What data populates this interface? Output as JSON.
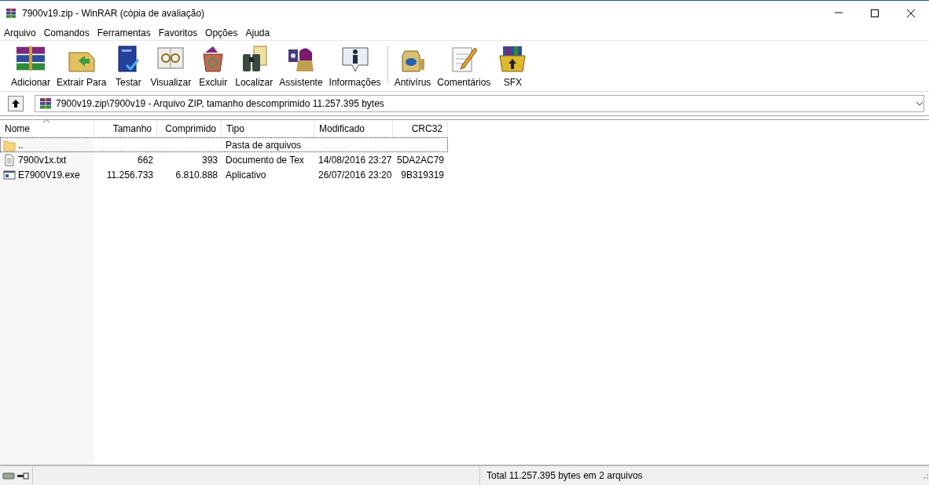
{
  "window": {
    "title": "7900v19.zip - WinRAR (cópia de avaliação)"
  },
  "menu": [
    "Arquivo",
    "Comandos",
    "Ferramentas",
    "Favoritos",
    "Opções",
    "Ajuda"
  ],
  "toolbar": [
    {
      "label": "Adicionar",
      "separator_before": false
    },
    {
      "label": "Extrair Para",
      "separator_before": false
    },
    {
      "label": "Testar",
      "separator_before": false
    },
    {
      "label": "Visualizar",
      "separator_before": false
    },
    {
      "label": "Excluir",
      "separator_before": false
    },
    {
      "label": "Localizar",
      "separator_before": false
    },
    {
      "label": "Assistente",
      "separator_before": false
    },
    {
      "label": "Informações",
      "separator_before": false
    },
    {
      "label": "Antivírus",
      "separator_before": true
    },
    {
      "label": "Comentários",
      "separator_before": false
    },
    {
      "label": "SFX",
      "separator_before": false
    }
  ],
  "path": "7900v19.zip\\7900v19 - Arquivo ZIP, tamanho descomprimido 11.257.395 bytes",
  "table": {
    "columns": [
      {
        "label": "Nome",
        "sorted": true
      },
      {
        "label": "Tamanho",
        "sorted": false
      },
      {
        "label": "Comprimido",
        "sorted": false
      },
      {
        "label": "Tipo",
        "sorted": false
      },
      {
        "label": "Modificado",
        "sorted": false
      },
      {
        "label": "CRC32",
        "sorted": false
      }
    ],
    "rows": [
      {
        "kind": "folder",
        "focused": true,
        "cells": [
          "..",
          "",
          "",
          "Pasta de arquivos",
          "",
          ""
        ]
      },
      {
        "kind": "text",
        "focused": false,
        "cells": [
          "7900v1x.txt",
          "662",
          "393",
          "Documento de Tex",
          "14/08/2016 23:27",
          "5DA2AC79"
        ]
      },
      {
        "kind": "exe",
        "focused": false,
        "cells": [
          "E7900V19.exe",
          "11.256.733",
          "6.810.888",
          "Aplicativo",
          "26/07/2016 23:20",
          "9B319319"
        ]
      }
    ]
  },
  "status_bar": {
    "text": "Total 11.257.395 bytes em 2 arquivos"
  }
}
